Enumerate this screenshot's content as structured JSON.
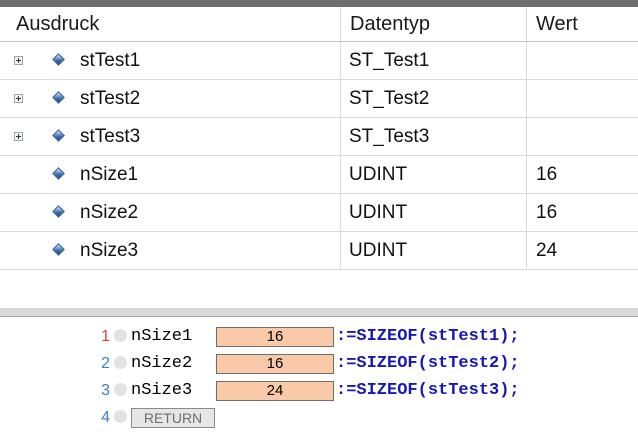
{
  "watch": {
    "headers": {
      "expression": "Ausdruck",
      "datatype": "Datentyp",
      "value": "Wert"
    },
    "rows": [
      {
        "expression": "stTest1",
        "datatype": "ST_Test1",
        "value": "",
        "expandable": true
      },
      {
        "expression": "stTest2",
        "datatype": "ST_Test2",
        "value": "",
        "expandable": true
      },
      {
        "expression": "stTest3",
        "datatype": "ST_Test3",
        "value": "",
        "expandable": true
      },
      {
        "expression": "nSize1",
        "datatype": "UDINT",
        "value": "16",
        "expandable": false
      },
      {
        "expression": "nSize2",
        "datatype": "UDINT",
        "value": "16",
        "expandable": false
      },
      {
        "expression": "nSize3",
        "datatype": "UDINT",
        "value": "24",
        "expandable": false
      }
    ]
  },
  "editor": {
    "lines": [
      {
        "num": "1",
        "var": "nSize1",
        "value": "16",
        "rest": ":=SIZEOF(stTest1);"
      },
      {
        "num": "2",
        "var": "nSize2",
        "value": "16",
        "rest": ":=SIZEOF(stTest2);"
      },
      {
        "num": "3",
        "var": "nSize3",
        "value": "24",
        "rest": ":=SIZEOF(stTest3);"
      }
    ],
    "return_line": {
      "num": "4",
      "label": "RETURN"
    },
    "colors": {
      "line_number": "#e0403a",
      "line_number_return": "#3a7fd0",
      "keyword": "#1717b5",
      "value_box": "#fac9a8"
    }
  }
}
